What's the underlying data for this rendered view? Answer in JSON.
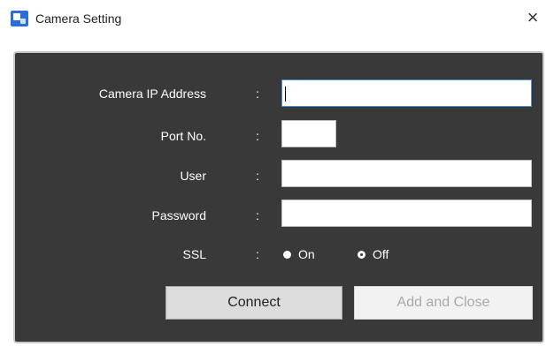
{
  "window": {
    "title": "Camera Setting",
    "close_glyph": "×",
    "icon": "camera-settings-icon"
  },
  "form": {
    "ip_label": "Camera IP Address",
    "port_label": "Port No.",
    "user_label": "User",
    "password_label": "Password",
    "ssl_label": "SSL",
    "separator": ":",
    "ip_value": "",
    "port_value": "",
    "user_value": "",
    "password_value": "",
    "ssl_options": [
      {
        "label": "On",
        "selected": true
      },
      {
        "label": "Off",
        "selected": false
      }
    ]
  },
  "buttons": {
    "connect_label": "Connect",
    "add_close_label": "Add and Close"
  },
  "colors": {
    "panel_bg": "#3a3939",
    "panel_border": "#c8c8c8",
    "text_light": "#ffffff",
    "disabled_text": "#a8a8a8"
  }
}
